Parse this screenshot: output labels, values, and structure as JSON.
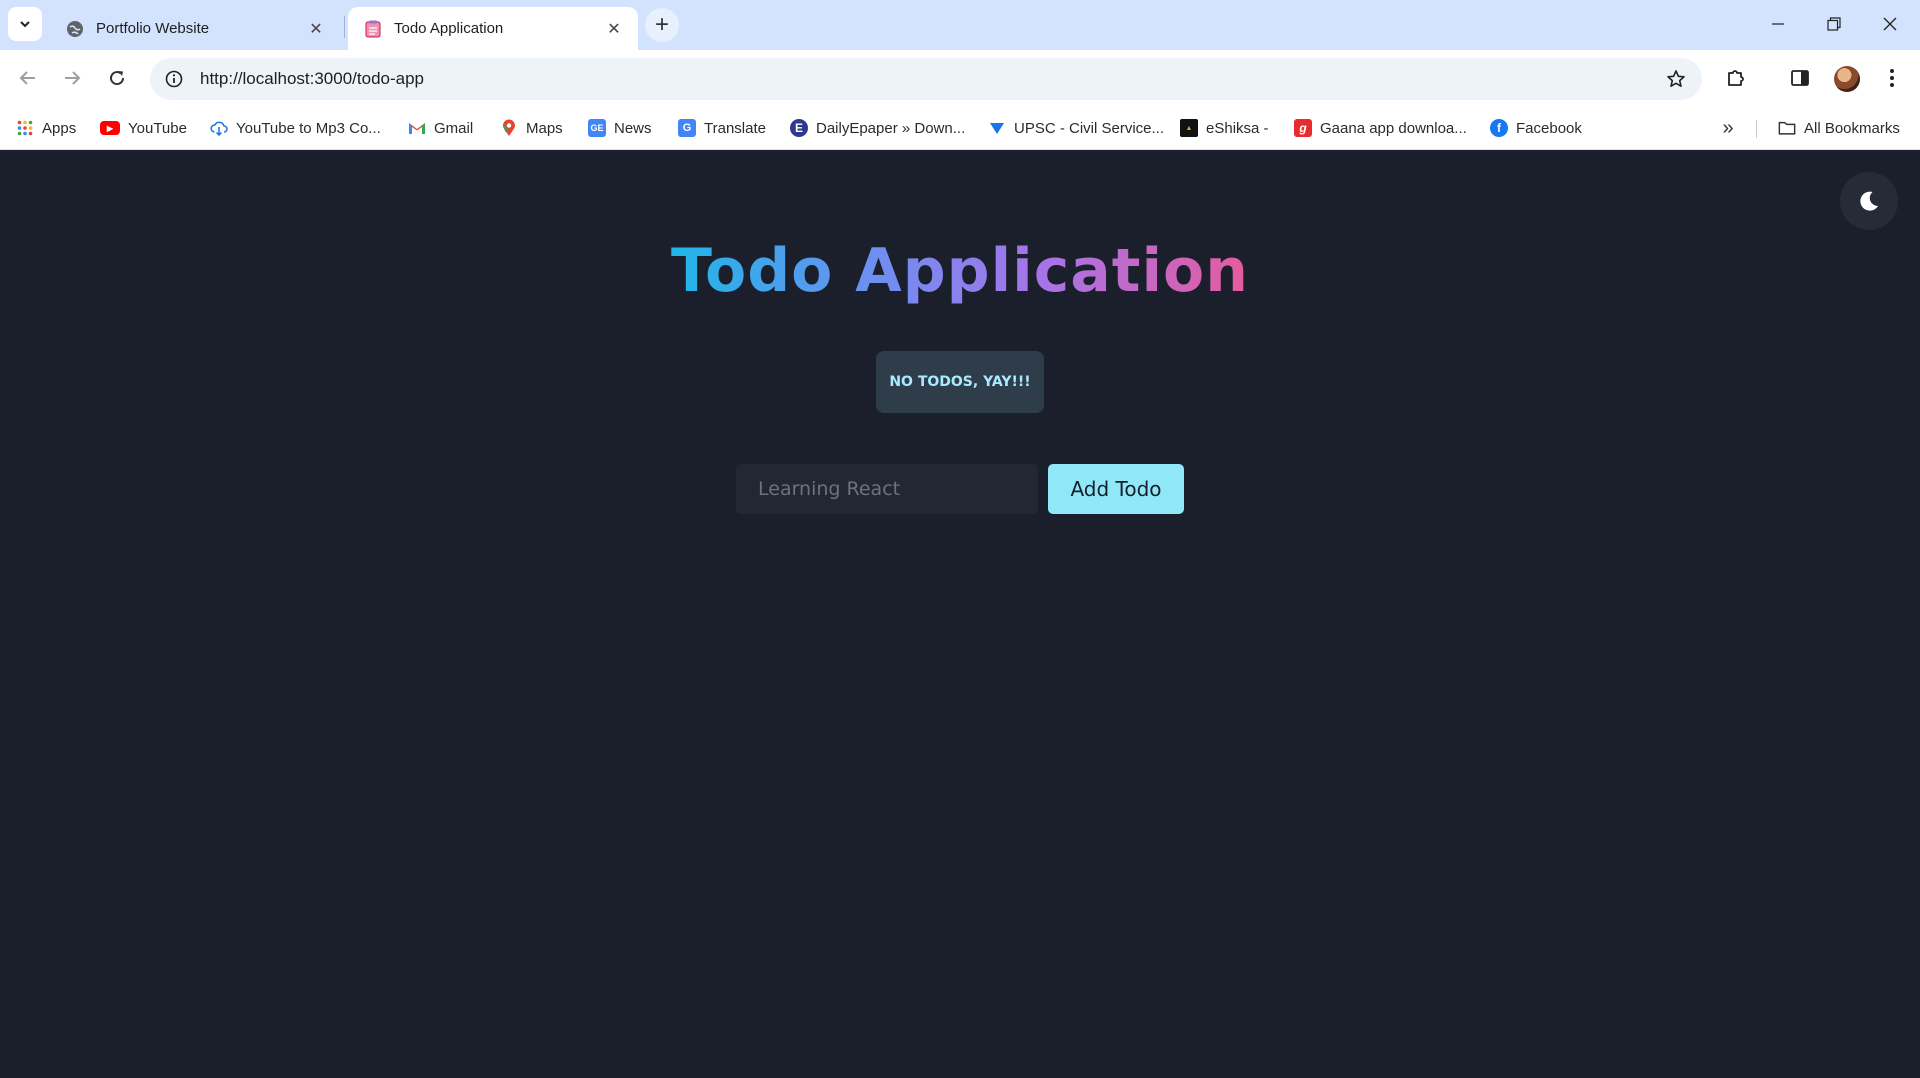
{
  "browser": {
    "tabs": [
      {
        "title": "Portfolio Website",
        "favicon": "globe-icon"
      },
      {
        "title": "Todo Application",
        "favicon": "notepad-icon"
      }
    ],
    "url": "http://localhost:3000/todo-app",
    "bookmarks": [
      {
        "label": "Apps",
        "icon": "apps-grid-icon"
      },
      {
        "label": "YouTube",
        "icon": "youtube-icon"
      },
      {
        "label": "YouTube to Mp3 Co...",
        "icon": "download-cloud-icon"
      },
      {
        "label": "Gmail",
        "icon": "gmail-icon"
      },
      {
        "label": "Maps",
        "icon": "maps-pin-icon"
      },
      {
        "label": "News",
        "icon": "news-icon"
      },
      {
        "label": "Translate",
        "icon": "translate-icon"
      },
      {
        "label": "DailyEpaper » Down...",
        "icon": "e-circle-icon"
      },
      {
        "label": "UPSC - Civil Service...",
        "icon": "upsc-icon"
      },
      {
        "label": "eShiksa -",
        "icon": "eshiksa-icon"
      },
      {
        "label": "Gaana app downloa...",
        "icon": "gaana-icon"
      },
      {
        "label": "Facebook",
        "icon": "facebook-icon"
      }
    ],
    "all_bookmarks_label": "All Bookmarks"
  },
  "app": {
    "title": "Todo Application",
    "empty_message": "NO TODOS, YAY!!!",
    "input": {
      "placeholder": "Learning React",
      "value": ""
    },
    "add_button_label": "Add Todo",
    "theme_toggle_icon": "moon-icon"
  },
  "colors": {
    "background": "#1b1f2b",
    "title_gradient": [
      "#1fb6e8",
      "#a873e8",
      "#e45c9c"
    ],
    "badge_bg": "#2f3d4b",
    "badge_text": "#a9eaff",
    "button_bg": "#8fe7f7"
  }
}
